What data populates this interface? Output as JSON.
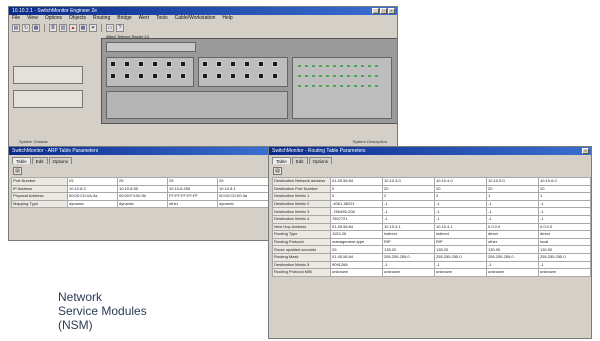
{
  "main_window": {
    "title": "10.10.2.1 - SwitchMonitor Engineer 2e",
    "menu": [
      "File",
      "View",
      "Options",
      "Objects",
      "Routing",
      "Bridge",
      "Alert",
      "Tools",
      "Cable/Workstation",
      "Help"
    ],
    "chassis_label": "Allied Telesyn  Rapier 24",
    "status_left": "System Chassis",
    "status_right": "System Description"
  },
  "arp_window": {
    "title": "SwitchMonitor - ARP Table Parameters",
    "tabs": [
      "Table",
      "Edit",
      "Options"
    ],
    "rows": [
      [
        "Port Number",
        "25",
        "25",
        "25",
        "25"
      ],
      [
        "IP Address",
        "10.10.8.2",
        "10.10.8.55",
        "10.10.8.255",
        "10.10.8.1"
      ],
      [
        "Physical Address",
        "00:00:CD:0A:3a",
        "00:00:F4:00:3b",
        "FF:FF:FF:FF:FF",
        "00:00:CD:00:3a"
      ],
      [
        "Mapping Type",
        "dynamic",
        "dynamic",
        "other",
        "dynamic"
      ]
    ]
  },
  "routing_window": {
    "title": "SwitchMonitor - Routing Table Parameters",
    "tabs": [
      "Table",
      "Edit",
      "Options"
    ],
    "rows": [
      [
        "Destination Network address",
        "01.45.56.84",
        "10.10.3.0",
        "10.10.4.0",
        "10.10.5.0",
        "10.10.6.0"
      ],
      [
        "Destination Port Number",
        "0",
        "20",
        "20",
        "20",
        "20"
      ],
      [
        "Destination Metric 1",
        "0",
        "2",
        "2",
        "1",
        "1"
      ],
      [
        "Destination Metric 2",
        "-4061-58221",
        "-1",
        "-1",
        "-1",
        "-1"
      ],
      [
        "Destination Metric 3",
        "-786495-208",
        "-1",
        "-1",
        "-1",
        "-1"
      ],
      [
        "Destination Metric 4",
        "7807721",
        "-1",
        "-1",
        "-1",
        "-1"
      ],
      [
        "Next Hop Address",
        "01.45.56.84",
        "10.10.4.1",
        "10.10.4.1",
        "0.0.0.0",
        "0.0.0.0"
      ],
      [
        "Routing Type",
        "1103.26",
        "indirect",
        "indirect",
        "direct",
        "direct"
      ],
      [
        "Routing Protocol",
        "management-type",
        "RIP",
        "RIP",
        "other",
        "local"
      ],
      [
        "Route updated seconds",
        "29",
        "135.20",
        "135.20",
        "130.00",
        "130.00"
      ],
      [
        "Routing Mask",
        "01.45.56.84",
        "255.255.255.0",
        "255.255.255.0",
        "255.255.255.0",
        "255.255.255.0"
      ],
      [
        "Destination Metric 5",
        "9091268",
        "-1",
        "-1",
        "-1",
        "-1"
      ],
      [
        "Routing Protocol MIB",
        "unknown",
        "unknown",
        "unknown",
        "unknown",
        "unknown"
      ]
    ]
  },
  "caption": {
    "line1": "Network",
    "line2": "Service Modules",
    "line3": "(NSM)"
  },
  "colors": {
    "titlebar": "#0a2a8a",
    "window_bg": "#d4d0c8",
    "caption_text": "#2d3a55",
    "port_led": "#4da54d"
  }
}
